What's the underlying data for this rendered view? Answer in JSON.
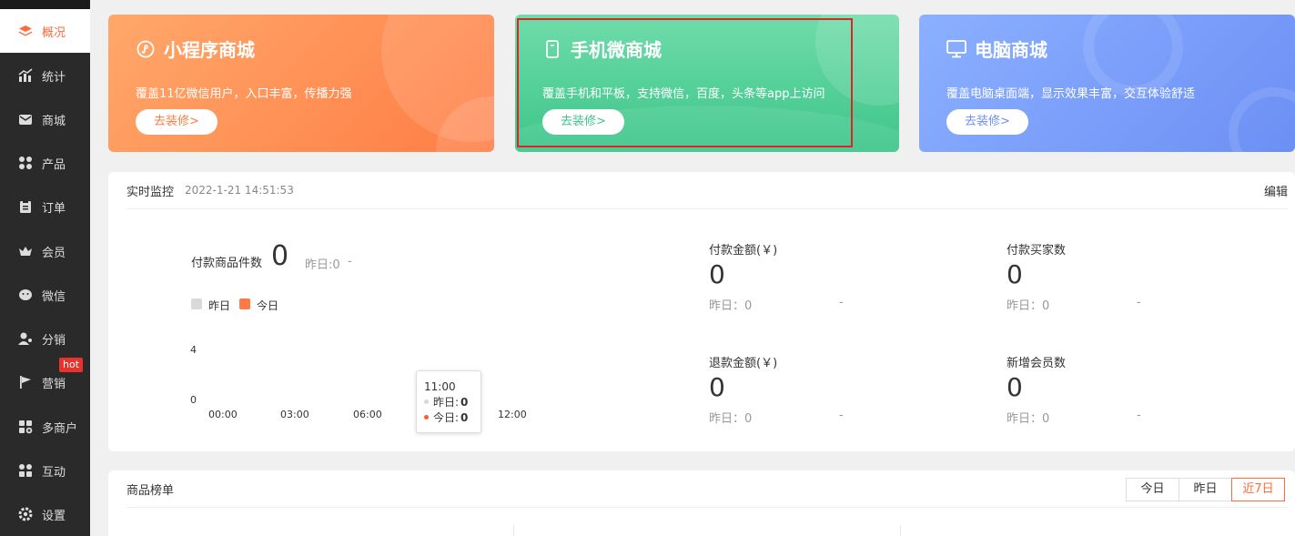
{
  "sidebar": {
    "items": [
      {
        "label": "概况",
        "icon": "layers-icon",
        "active": true
      },
      {
        "label": "统计",
        "icon": "chart-icon"
      },
      {
        "label": "商城",
        "icon": "mail-icon"
      },
      {
        "label": "产品",
        "icon": "grid-icon"
      },
      {
        "label": "订单",
        "icon": "clipboard-icon"
      },
      {
        "label": "会员",
        "icon": "crown-icon"
      },
      {
        "label": "微信",
        "icon": "wechat-icon"
      },
      {
        "label": "分销",
        "icon": "user-share-icon"
      },
      {
        "label": "营销",
        "icon": "flag-icon"
      },
      {
        "label": "多商户",
        "icon": "multi-store-icon"
      },
      {
        "label": "互动",
        "icon": "interact-icon"
      },
      {
        "label": "设置",
        "icon": "gear-icon"
      }
    ],
    "hot_badge": "hot"
  },
  "cards": [
    {
      "title": "小程序商城",
      "desc": "覆盖11亿微信用户，入口丰富，传播力强",
      "button": "去装修>",
      "icon": "mini-program-icon",
      "color": "#ff8a50"
    },
    {
      "title": "手机微商城",
      "desc": "覆盖手机和平板，支持微信，百度，头条等app上访问",
      "button": "去装修>",
      "icon": "phone-icon",
      "color": "#4fcf95"
    },
    {
      "title": "电脑商城",
      "desc": "覆盖电脑桌面端，显示效果丰富，交互体验舒适",
      "button": "去装修>",
      "icon": "monitor-icon",
      "color": "#7a9cfb"
    }
  ],
  "monitor": {
    "title": "实时监控",
    "time": "2022-1-21 14:51:53",
    "edit": "编辑",
    "goods_count": {
      "label": "付款商品件数",
      "value": "0",
      "yesterday": "昨日:0",
      "dash": "-"
    },
    "legend": {
      "yesterday": "昨日",
      "today": "今日",
      "yesterday_color": "#d9d9d9",
      "today_color": "#ff7a45"
    },
    "chart": {
      "y_ticks": [
        "4",
        "0"
      ],
      "x_ticks": [
        "00:00",
        "03:00",
        "06:00",
        "12:00"
      ]
    },
    "tooltip": {
      "time": "11:00",
      "yesterday_label": "昨日:",
      "yesterday_value": "0",
      "today_label": "今日:",
      "today_value": "0"
    },
    "metrics": [
      {
        "label": "付款金额(￥)",
        "value": "0",
        "yesterday": "昨日：0",
        "dash": "-"
      },
      {
        "label": "付款买家数",
        "value": "0",
        "yesterday": "昨日：0",
        "dash": "-"
      },
      {
        "label": "退款金额(￥)",
        "value": "0",
        "yesterday": "昨日：0",
        "dash": "-"
      },
      {
        "label": "新增会员数",
        "value": "0",
        "yesterday": "昨日：0",
        "dash": "-"
      }
    ]
  },
  "rank": {
    "title": "商品榜单",
    "tabs": [
      "今日",
      "昨日",
      "近7日"
    ],
    "active_tab": 2
  },
  "colors": {
    "accent": "#ff6a3a",
    "sidebar_bg": "#2a2a2a",
    "highlight": "#d9262b"
  }
}
